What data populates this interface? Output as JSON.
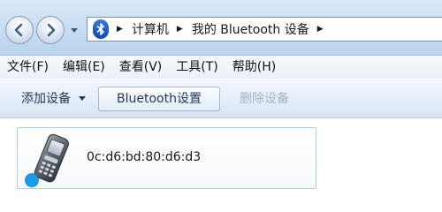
{
  "nav": {
    "back_icon": "back-arrow-icon",
    "forward_icon": "forward-arrow-icon",
    "history_icon": "chevron-down-icon"
  },
  "address": {
    "root_icon": "bluetooth-icon",
    "crumbs": [
      "计算机",
      "我的 Bluetooth 设备"
    ]
  },
  "menu": {
    "items": [
      "文件(F)",
      "编辑(E)",
      "查看(V)",
      "工具(T)",
      "帮助(H)"
    ]
  },
  "commands": {
    "add_device": "添加设备",
    "bluetooth_settings": "Bluetooth设置",
    "remove_device": "删除设备"
  },
  "devices": [
    {
      "name": "0c:d6:bd:80:d6:d3",
      "icon": "mobile-phone-icon",
      "status_color": "#1e9be6"
    }
  ],
  "colors": {
    "accent": "#1e9be6",
    "bluetooth_badge": "#1551b8"
  }
}
